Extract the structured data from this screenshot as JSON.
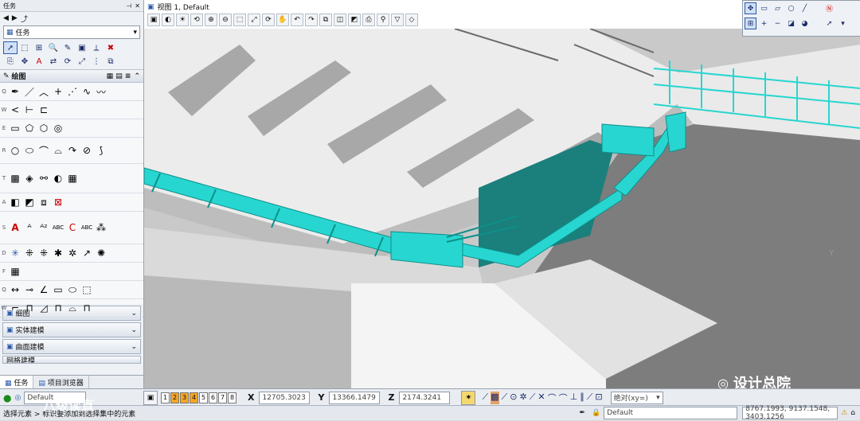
{
  "task_panel": {
    "title": "任务",
    "combo_value": "任务",
    "drawing_header": "绘图",
    "row_keys": [
      "Q",
      "W",
      "E",
      "R",
      "T",
      "A",
      "S",
      "D",
      "F"
    ],
    "collapsed_sections": [
      "细图",
      "实体建模",
      "曲面建模",
      "网格建模"
    ],
    "bottom_tabs": [
      "任务",
      "项目浏览器"
    ]
  },
  "view": {
    "title": "视图 1, Default"
  },
  "status_bar": {
    "view_buttons": [
      "1",
      "2",
      "3",
      "4",
      "5",
      "6",
      "7",
      "8"
    ],
    "x_label": "X",
    "x_value": "12705.3023",
    "y_label": "Y",
    "y_value": "13366.1479",
    "z_label": "Z",
    "z_value": "2174.3241",
    "level_value": "Default",
    "snap_mode": "绝对(xy=)"
  },
  "prompt_bar": {
    "prompt": "选择元素 > 标识要添加到选择集中的元素",
    "level": "Default",
    "coords": "8767.1993, 9137.1548, 3403.1256"
  },
  "watermark": {
    "brand": "设计总院",
    "left_text": "八级读直"
  },
  "colors": {
    "pipe": "#27d6d0",
    "pipe_dark": "#0e8f8a",
    "bridge_light": "#e8e8e8",
    "bridge_mid": "#9e9e9e",
    "bridge_dark": "#6f6f6f",
    "active_view": "#f5a623"
  },
  "icons": {
    "select": "arrow-select-icon",
    "palette": [
      "snap-icon",
      "rect-icon",
      "ellipse-icon",
      "line-icon",
      "north-icon"
    ]
  }
}
